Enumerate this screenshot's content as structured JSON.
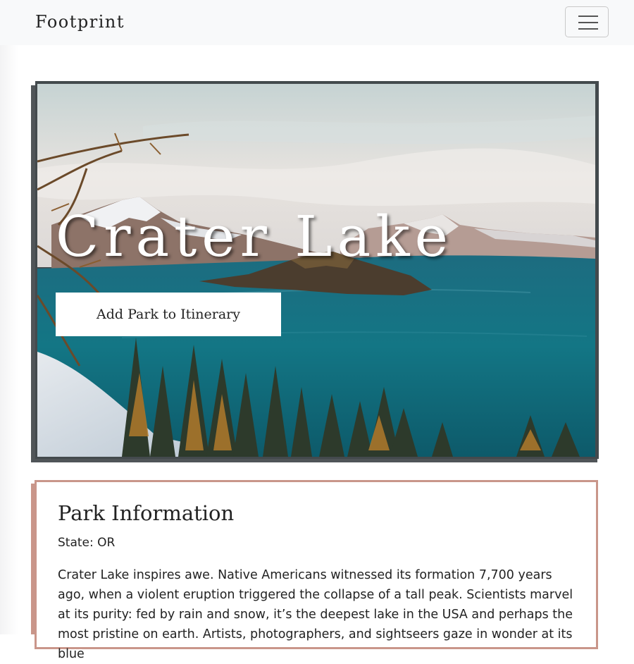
{
  "navbar": {
    "brand": "Footprint",
    "menu_icon": "hamburger-menu-icon"
  },
  "hero": {
    "title": "Crater Lake",
    "add_button_label": "Add Park to Itinerary",
    "image": "crater-lake-landscape-photo"
  },
  "info": {
    "heading": "Park Information",
    "state": "State: OR",
    "description": "Crater Lake inspires awe. Native Americans witnessed its formation 7,700 years ago, when a violent eruption triggered the collapse of a tall peak. Scientists marvel at its purity: fed by rain and snow, it’s the deepest lake in the USA and perhaps the most pristine on earth. Artists, photographers, and sightseers gaze in wonder at its blue"
  },
  "colors": {
    "navbar_bg": "#f8f9fa",
    "hero_frame": "#434a4d",
    "card_border": "#c9968a",
    "lake_blue": "#137685"
  }
}
